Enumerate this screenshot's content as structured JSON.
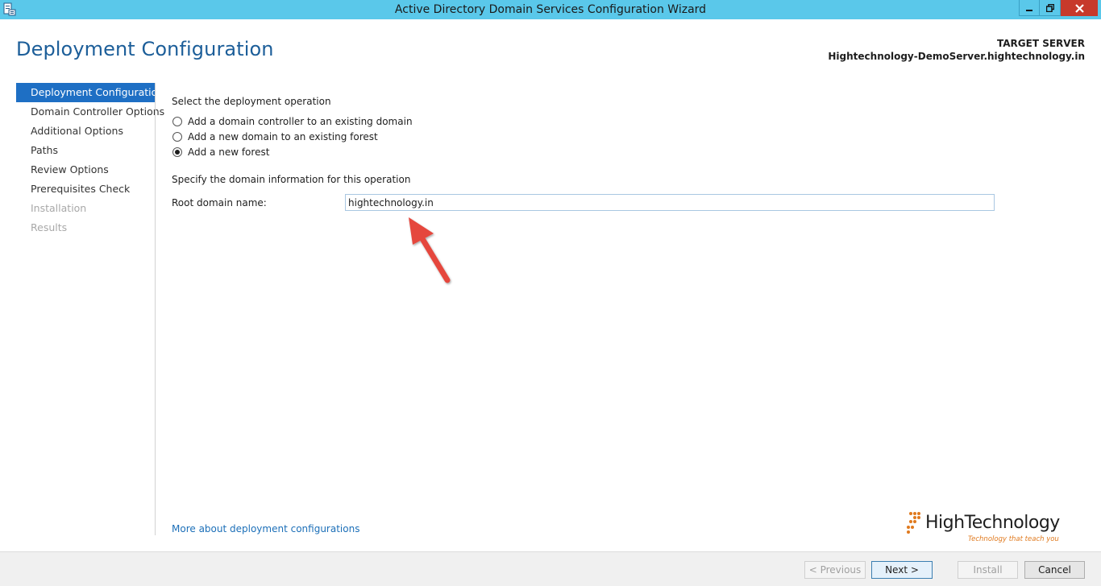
{
  "window": {
    "title": "Active Directory Domain Services Configuration Wizard",
    "accent_color": "#5ac8ea",
    "close_color": "#c7392b"
  },
  "header": {
    "page_title": "Deployment Configuration",
    "target_label": "TARGET SERVER",
    "target_name": "Hightechnology-DemoServer.hightechnology.in"
  },
  "nav": {
    "items": [
      {
        "label": "Deployment Configuration",
        "state": "active"
      },
      {
        "label": "Domain Controller Options",
        "state": "enabled"
      },
      {
        "label": "Additional Options",
        "state": "enabled"
      },
      {
        "label": "Paths",
        "state": "enabled"
      },
      {
        "label": "Review Options",
        "state": "enabled"
      },
      {
        "label": "Prerequisites Check",
        "state": "enabled"
      },
      {
        "label": "Installation",
        "state": "disabled"
      },
      {
        "label": "Results",
        "state": "disabled"
      }
    ]
  },
  "main": {
    "operation_heading": "Select the deployment operation",
    "options": [
      {
        "label": "Add a domain controller to an existing domain",
        "checked": false
      },
      {
        "label": "Add a new domain to an existing forest",
        "checked": false
      },
      {
        "label": "Add a new forest",
        "checked": true
      }
    ],
    "domain_heading": "Specify the domain information for this operation",
    "root_domain_label": "Root domain name:",
    "root_domain_value": "hightechnology.in",
    "more_link": "More about deployment configurations"
  },
  "logo": {
    "name": "HighTechnology",
    "tagline": "Technology that teach you"
  },
  "footer": {
    "previous_label": "< Previous",
    "next_label": "Next >",
    "install_label": "Install",
    "cancel_label": "Cancel"
  }
}
